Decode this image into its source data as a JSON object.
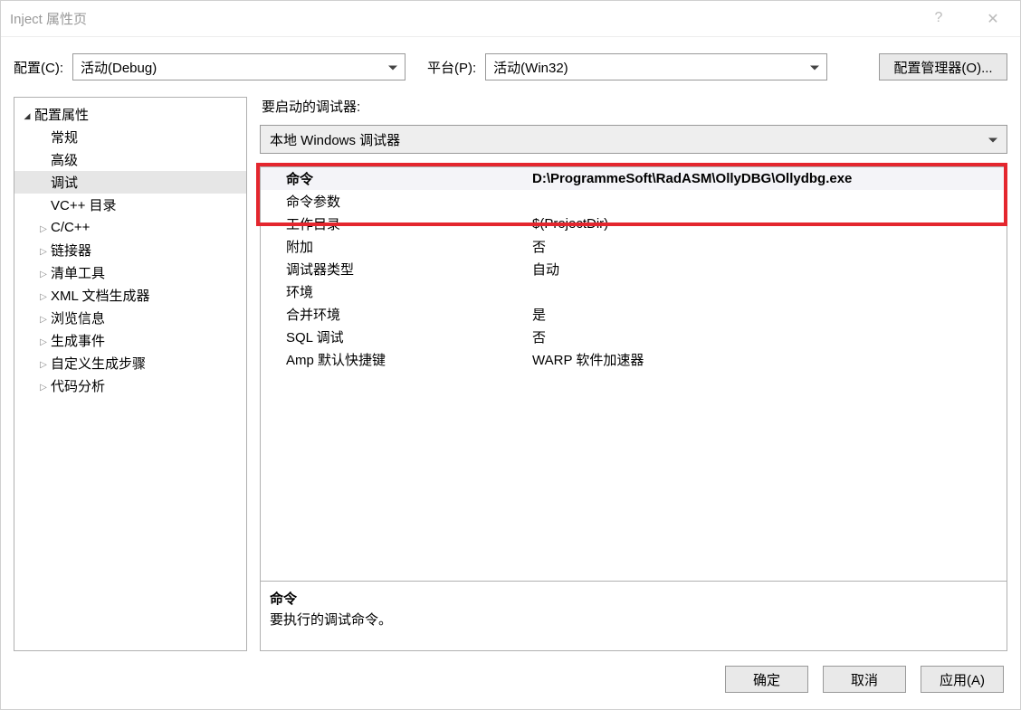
{
  "window": {
    "title": "Inject 属性页",
    "help_icon": "?",
    "close_icon": "✕"
  },
  "toolbar": {
    "config_label": "配置(C):",
    "config_value": "活动(Debug)",
    "platform_label": "平台(P):",
    "platform_value": "活动(Win32)",
    "config_manager_label": "配置管理器(O)..."
  },
  "tree": {
    "items": [
      {
        "label": "配置属性",
        "depth": 0,
        "expandable": true,
        "expanded": true,
        "selected": false
      },
      {
        "label": "常规",
        "depth": 1,
        "expandable": false,
        "expanded": false,
        "selected": false
      },
      {
        "label": "高级",
        "depth": 1,
        "expandable": false,
        "expanded": false,
        "selected": false
      },
      {
        "label": "调试",
        "depth": 1,
        "expandable": false,
        "expanded": false,
        "selected": true
      },
      {
        "label": "VC++ 目录",
        "depth": 1,
        "expandable": false,
        "expanded": false,
        "selected": false
      },
      {
        "label": "C/C++",
        "depth": 1,
        "expandable": true,
        "expanded": false,
        "selected": false
      },
      {
        "label": "链接器",
        "depth": 1,
        "expandable": true,
        "expanded": false,
        "selected": false
      },
      {
        "label": "清单工具",
        "depth": 1,
        "expandable": true,
        "expanded": false,
        "selected": false
      },
      {
        "label": "XML 文档生成器",
        "depth": 1,
        "expandable": true,
        "expanded": false,
        "selected": false
      },
      {
        "label": "浏览信息",
        "depth": 1,
        "expandable": true,
        "expanded": false,
        "selected": false
      },
      {
        "label": "生成事件",
        "depth": 1,
        "expandable": true,
        "expanded": false,
        "selected": false
      },
      {
        "label": "自定义生成步骤",
        "depth": 1,
        "expandable": true,
        "expanded": false,
        "selected": false
      },
      {
        "label": "代码分析",
        "depth": 1,
        "expandable": true,
        "expanded": false,
        "selected": false
      }
    ]
  },
  "right": {
    "header_label": "要启动的调试器:",
    "debugger_value": "本地 Windows 调试器",
    "grid_rows": [
      {
        "label": "命令",
        "value": "D:\\ProgrammeSoft\\RadASM\\OllyDBG\\Ollydbg.exe",
        "bold": true,
        "selected": true
      },
      {
        "label": "命令参数",
        "value": "",
        "bold": false,
        "selected": false
      },
      {
        "label": "工作目录",
        "value": "$(ProjectDir)",
        "bold": false,
        "selected": false
      },
      {
        "label": "附加",
        "value": "否",
        "bold": false,
        "selected": false
      },
      {
        "label": "调试器类型",
        "value": "自动",
        "bold": false,
        "selected": false
      },
      {
        "label": "环境",
        "value": "",
        "bold": false,
        "selected": false
      },
      {
        "label": "合并环境",
        "value": "是",
        "bold": false,
        "selected": false
      },
      {
        "label": "SQL 调试",
        "value": "否",
        "bold": false,
        "selected": false
      },
      {
        "label": "Amp 默认快捷键",
        "value": "WARP 软件加速器",
        "bold": false,
        "selected": false
      }
    ],
    "description": {
      "title": "命令",
      "text": "要执行的调试命令。"
    }
  },
  "footer": {
    "ok_label": "确定",
    "cancel_label": "取消",
    "apply_label": "应用(A)"
  }
}
